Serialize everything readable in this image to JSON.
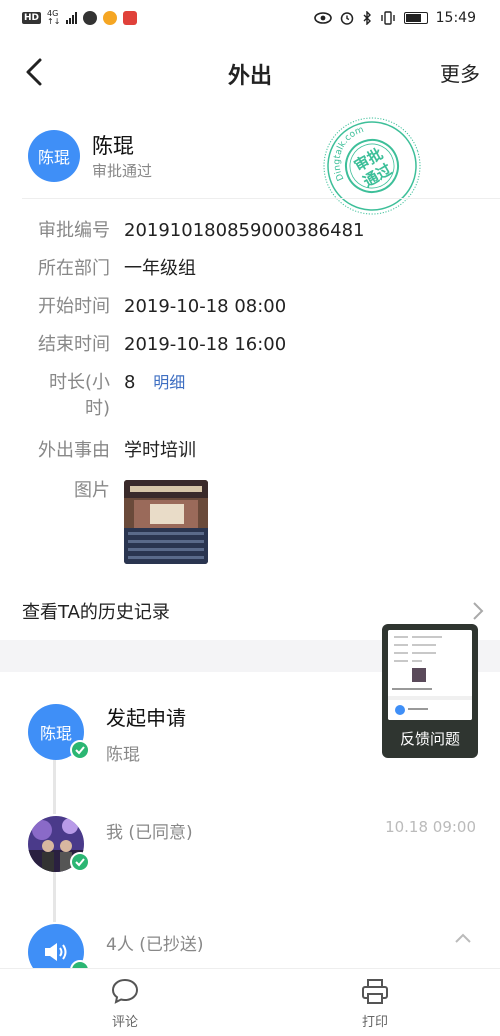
{
  "status_bar": {
    "chip": "HD",
    "network_top": "4G",
    "network_bottom": "↑↓",
    "time": "15:49",
    "right_icons": [
      "eye-icon",
      "alarm-icon",
      "bluetooth-icon",
      "vibrate-icon",
      "battery-icon"
    ]
  },
  "nav": {
    "title": "外出",
    "more": "更多"
  },
  "header": {
    "avatar": "陈琨",
    "name": "陈琨",
    "status": "审批通过",
    "stamp_text_top": "审批",
    "stamp_text_bottom": "通过",
    "stamp_ring": "Dingtalk.com",
    "stamp_color": "#3dbf99"
  },
  "details": [
    {
      "label": "审批编号",
      "value": "20191018085900038648​1"
    },
    {
      "label": "所在部门",
      "value": "一年级组"
    },
    {
      "label": "开始时间",
      "value": "2019-10-18 08:00"
    },
    {
      "label": "结束时间",
      "value": "2019-10-18 16:00"
    },
    {
      "label_line1": "时长(小",
      "label_line2": "时)",
      "value": "8",
      "link": "明细"
    },
    {
      "label": "外出事由",
      "value": "学时培训"
    },
    {
      "label": "图片"
    }
  ],
  "history": {
    "label": "查看TA的历史记录"
  },
  "feedback": {
    "label": "反馈问题"
  },
  "timeline": [
    {
      "avatar": "陈琨",
      "title": "发起申请",
      "sub": "陈琨"
    },
    {
      "title": "我 (已同意)",
      "time": "10.18 09:00"
    },
    {
      "title": "4人 (已抄送)"
    }
  ],
  "bottom_bar": {
    "comment": "评论",
    "print": "打印"
  },
  "colors": {
    "accent_blue": "#3f8ff7",
    "success_green": "#2bb673",
    "link_blue": "#3f6fc2"
  }
}
